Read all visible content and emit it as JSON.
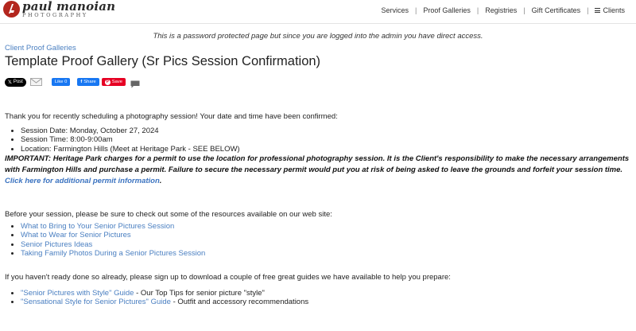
{
  "header": {
    "logo_name": "paul manoian",
    "logo_sub": "PHOTOGRAPHY",
    "nav": [
      "Services",
      "Proof Galleries",
      "Registries",
      "Gift Certificates"
    ],
    "nav_separator": "|",
    "clients_label": "Clients"
  },
  "notice": "This is a password protected page but since you are logged into the admin you have direct access.",
  "breadcrumb": "Client Proof Galleries",
  "title": "Template Proof Gallery (Sr Pics Session Confirmation)",
  "social": {
    "x_post": "Post",
    "fb_like": "Like 0",
    "fb_share": "Share",
    "pin_save": "Save"
  },
  "content": {
    "intro": "Thank you for recently scheduling a photography session! Your date and time have been confirmed:",
    "details": [
      "Session Date: Monday, October 27, 2024",
      "Session Time: 8:00-9:00am",
      "Location: Farmington Hills (Meet at Heritage Park - SEE BELOW)"
    ],
    "important_text": "IMPORTANT: Heritage Park charges for a permit to use the location for professional photography session. It is the Client's responsibility to make the necessary arrangements with Farmington Hills and purchase a permit. Failure to secure the necessary permit would put you at risk of being asked to leave the grounds and forfeit your session time.",
    "important_link": "Click here for additional permit information",
    "important_end": ".",
    "resources_intro": "Before your session, please be sure to check out some of the resources available on our web site:",
    "resources": [
      "What to Bring to Your Senior Pictures Session",
      "What to Wear for Senior Pictures",
      "Senior Pictures Ideas",
      "Taking Family Photos During a Senior Pictures Session"
    ],
    "guides_intro": "If you haven't ready done so already, please sign up to download a couple of free great guides we have available to help you prepare:",
    "guides": [
      {
        "link": "\"Senior Pictures with Style\" Guide",
        "desc": " - Our Top Tips for senior picture \"style\""
      },
      {
        "link": "\"Sensational Style for Senior Pictures\" Guide",
        "desc": " - Outfit and accessory recommendations"
      }
    ]
  }
}
